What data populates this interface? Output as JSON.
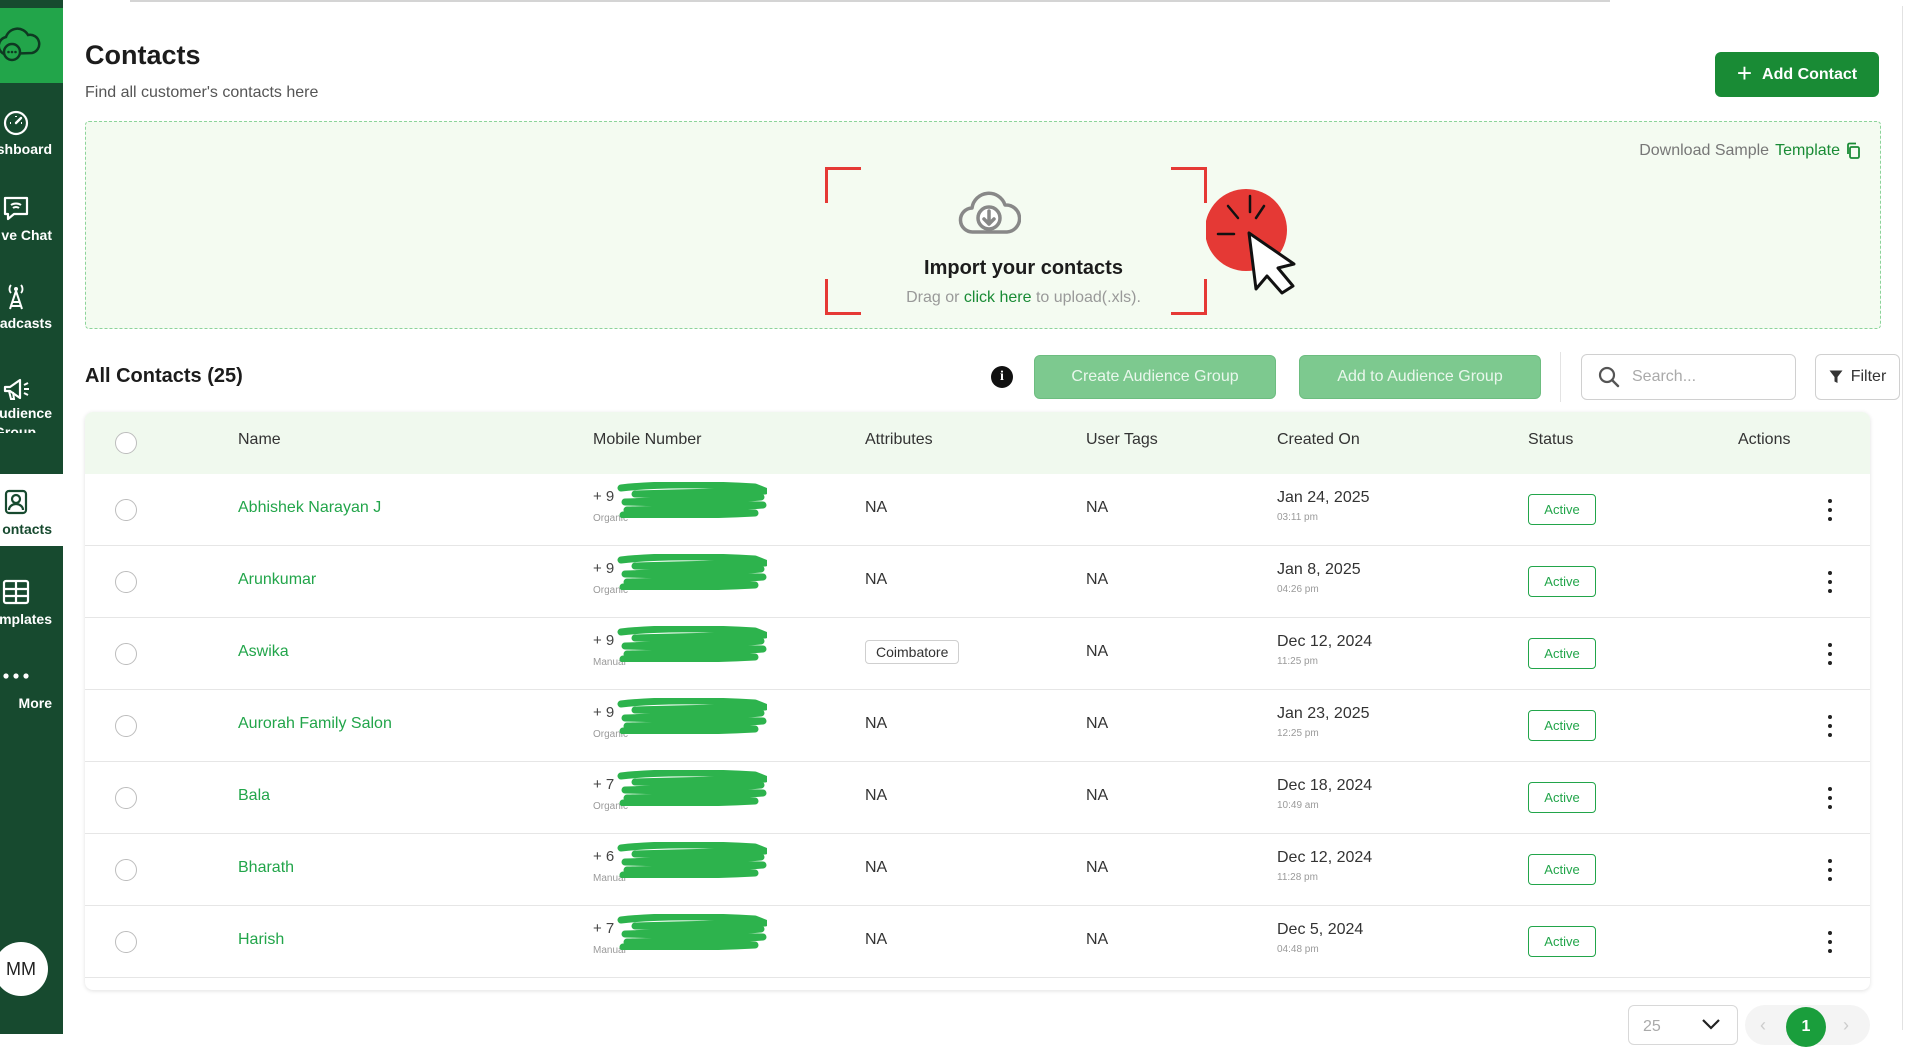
{
  "sidebar": {
    "items": [
      {
        "label": "shboard",
        "label2": "",
        "icon": "dashboard-icon"
      },
      {
        "label": "ve Chat",
        "label2": "",
        "icon": "live-chat-icon"
      },
      {
        "label": "oadcasts",
        "label2": "",
        "icon": "broadcast-tower-icon"
      },
      {
        "label": "udience",
        "label2": "Group",
        "icon": "megaphone-icon"
      },
      {
        "label": "ontacts",
        "label2": "",
        "icon": "contacts-icon"
      },
      {
        "label": "mplates",
        "label2": "",
        "icon": "templates-grid-icon"
      },
      {
        "label": "More",
        "label2": "",
        "icon": "more-dots-icon"
      }
    ],
    "avatar_initials": "MM"
  },
  "header": {
    "title": "Contacts",
    "subtitle": "Find all customer's contacts here",
    "add_button": "Add Contact"
  },
  "import": {
    "download_prefix": "Download Sample",
    "download_link": "Template",
    "title": "Import your contacts",
    "sub_prefix": "Drag or",
    "sub_link": "click here",
    "sub_suffix": "to upload(.xls)."
  },
  "toolbar": {
    "section_title": "All Contacts (25)",
    "info_glyph": "i",
    "create_group": "Create Audience Group",
    "add_to_group": "Add to Audience Group",
    "search_placeholder": "Search...",
    "filter": "Filter"
  },
  "table": {
    "columns": [
      "Name",
      "Mobile Number",
      "Attributes",
      "User Tags",
      "Created On",
      "Status",
      "Actions"
    ],
    "rows": [
      {
        "name": "Abhishek Narayan J",
        "mobile": "+ 9",
        "source": "Organic",
        "attribute": "NA",
        "attribute_is_tag": false,
        "tags": "NA",
        "date": "Jan 24, 2025",
        "time": "03:11 pm",
        "status": "Active"
      },
      {
        "name": "Arunkumar",
        "mobile": "+ 9",
        "source": "Organic",
        "attribute": "NA",
        "attribute_is_tag": false,
        "tags": "NA",
        "date": "Jan 8, 2025",
        "time": "04:26 pm",
        "status": "Active"
      },
      {
        "name": "Aswika",
        "mobile": "+ 9",
        "source": "Manual",
        "attribute": "Coimbatore",
        "attribute_is_tag": true,
        "tags": "NA",
        "date": "Dec 12, 2024",
        "time": "11:25 pm",
        "status": "Active"
      },
      {
        "name": "Aurorah Family Salon",
        "mobile": "+ 9",
        "source": "Organic",
        "attribute": "NA",
        "attribute_is_tag": false,
        "tags": "NA",
        "date": "Jan 23, 2025",
        "time": "12:25 pm",
        "status": "Active"
      },
      {
        "name": "Bala",
        "mobile": "+ 7",
        "source": "Organic",
        "attribute": "NA",
        "attribute_is_tag": false,
        "tags": "NA",
        "date": "Dec 18, 2024",
        "time": "10:49 am",
        "status": "Active"
      },
      {
        "name": "Bharath",
        "mobile": "+ 6",
        "source": "Manual",
        "attribute": "NA",
        "attribute_is_tag": false,
        "tags": "NA",
        "date": "Dec 12, 2024",
        "time": "11:28 pm",
        "status": "Active"
      },
      {
        "name": "Harish",
        "mobile": "+ 7",
        "source": "Manual",
        "attribute": "NA",
        "attribute_is_tag": false,
        "tags": "NA",
        "date": "Dec 5, 2024",
        "time": "04:48 pm",
        "status": "Active"
      }
    ]
  },
  "pagination": {
    "page_size": "25",
    "current_page": "1",
    "prev_glyph": "‹",
    "next_glyph": "›"
  },
  "colors": {
    "brand_green": "#198b35",
    "sidebar_bg": "#174a2f",
    "link_green": "#22a54a",
    "light_button": "#7dc98f",
    "redaction": "#2db34d",
    "click_red": "#e53935"
  }
}
